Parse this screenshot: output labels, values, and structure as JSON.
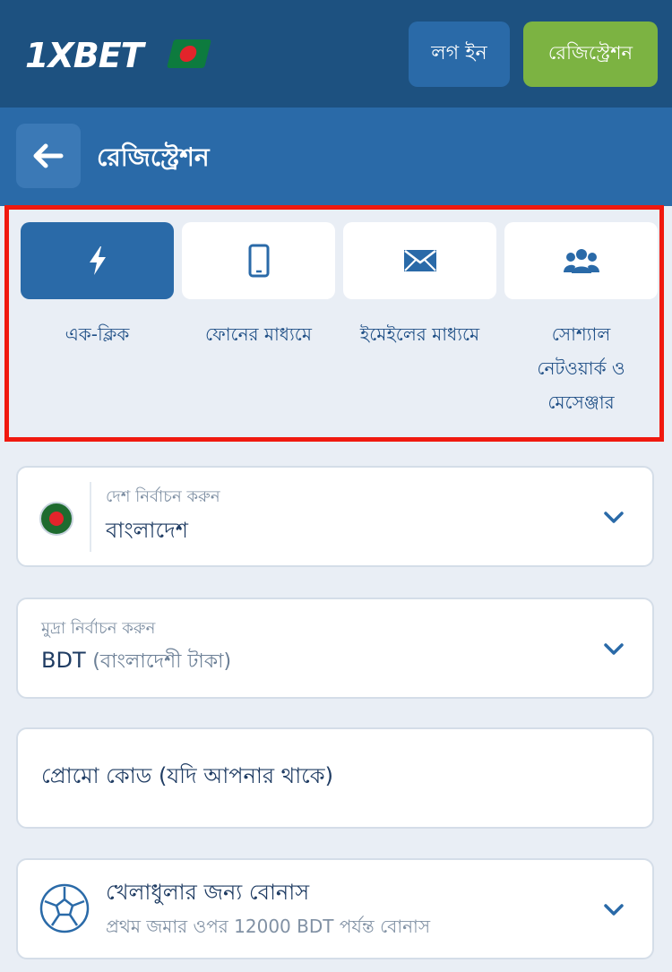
{
  "header": {
    "logo": "1XBET",
    "login_label": "লগ ইন",
    "register_label": "রেজিস্ট্রেশন"
  },
  "subheader": {
    "title": "রেজিস্ট্রেশন"
  },
  "methods": [
    {
      "label": "এক-ক্লিক",
      "icon": "lightning-icon",
      "active": true
    },
    {
      "label": "ফোনের মাধ্যমে",
      "icon": "phone-icon",
      "active": false
    },
    {
      "label": "ইমেইলের মাধ্যমে",
      "icon": "envelope-icon",
      "active": false
    },
    {
      "label": "সোশ্যাল নেটওয়ার্ক ও মেসেঞ্জার",
      "icon": "group-icon",
      "active": false
    }
  ],
  "form": {
    "country_label": "দেশ নির্বাচন করুন",
    "country_value": "বাংলাদেশ",
    "currency_label": "মুদ্রা নির্বাচন করুন",
    "currency_code": "BDT",
    "currency_name": "(বাংলাদেশী টাকা)",
    "promo_placeholder": "প্রোমো কোড (যদি আপনার থাকে)",
    "bonus_title": "খেলাধুলার জন্য বোনাস",
    "bonus_sub": "প্রথম জমার ওপর 12000 BDT পর্যন্ত বোনাস"
  },
  "colors": {
    "header_bg": "#1d5180",
    "subheader_bg": "#2a6aa8",
    "register_btn": "#7cb342",
    "highlight_border": "#f0190f"
  }
}
